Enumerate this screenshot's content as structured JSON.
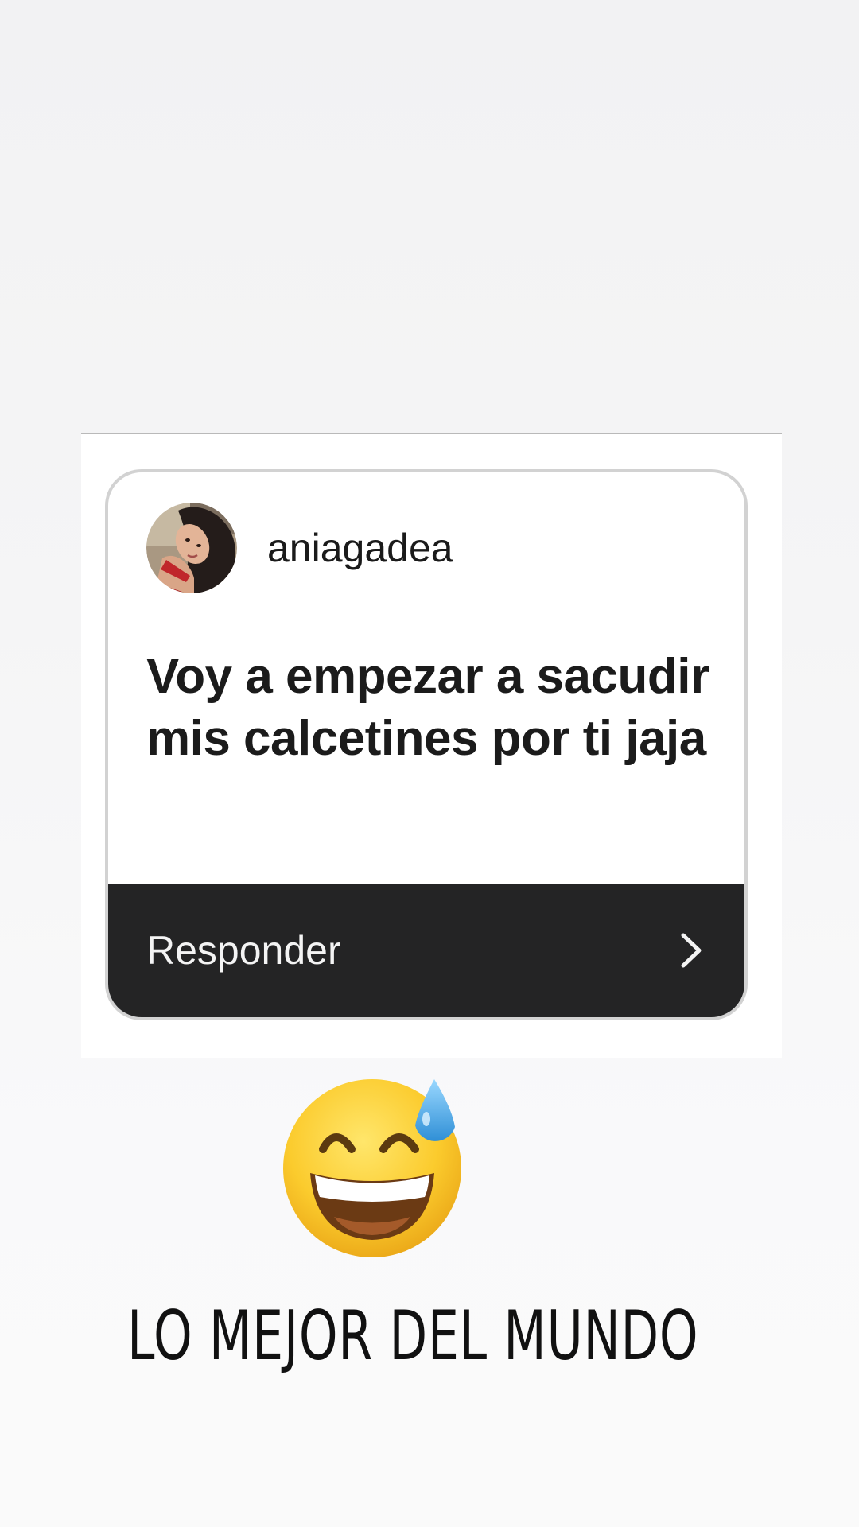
{
  "question_card": {
    "username": "aniagadea",
    "question": "Voy a empezar a sacudir mis calcetines por ti jaja",
    "reply_label": "Responder",
    "reply_icon": "chevron-right-icon",
    "avatar": "profile-photo"
  },
  "sticker": {
    "emoji": "grinning-face-with-sweat-emoji"
  },
  "caption": {
    "text": "LO MEJOR DEL MUNDO"
  },
  "colors": {
    "background": "#f4f4f5",
    "card_border": "#d2d2d2",
    "reply_bar": "#242425",
    "text_dark": "#1b1b1b",
    "emoji_yellow": "#f9c623",
    "sweat_drop": "#47aee8"
  }
}
